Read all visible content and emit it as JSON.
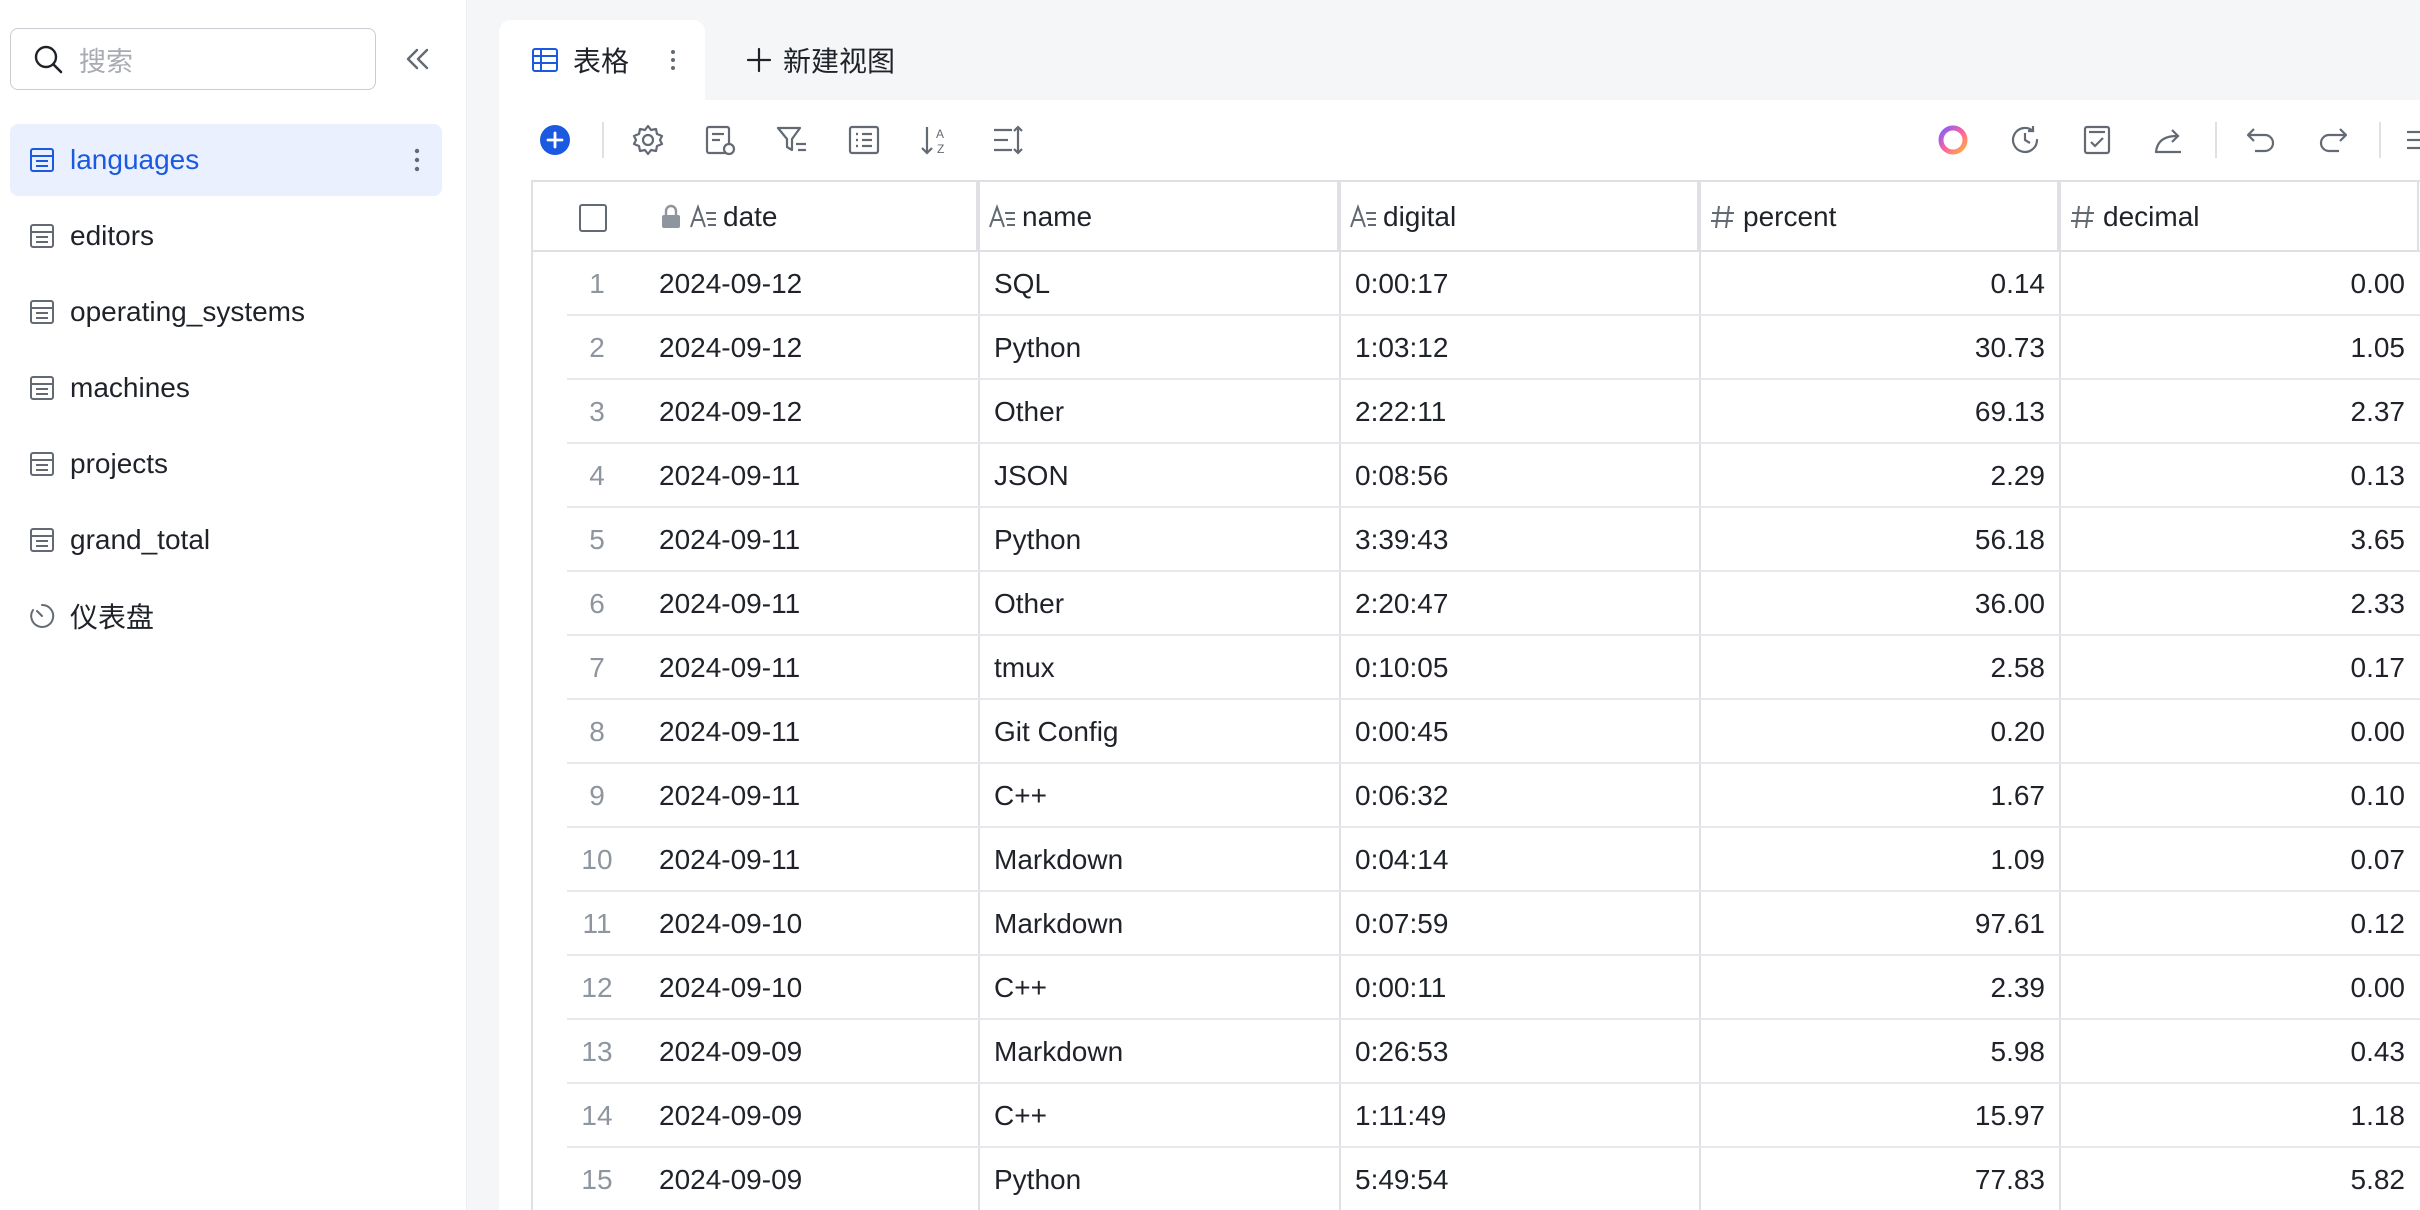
{
  "search": {
    "placeholder": "搜索"
  },
  "sidebar": {
    "items": [
      {
        "label": "languages",
        "icon": "table-icon",
        "active": true
      },
      {
        "label": "editors",
        "icon": "table-icon"
      },
      {
        "label": "operating_systems",
        "icon": "table-icon"
      },
      {
        "label": "machines",
        "icon": "table-icon"
      },
      {
        "label": "projects",
        "icon": "table-icon"
      },
      {
        "label": "grand_total",
        "icon": "table-icon"
      },
      {
        "label": "仪表盘",
        "icon": "dashboard-icon"
      }
    ]
  },
  "tabs": {
    "active_label": "表格",
    "new_view_label": "新建视图"
  },
  "table": {
    "columns": [
      {
        "label": "date",
        "type": "text",
        "locked": true
      },
      {
        "label": "name",
        "type": "text"
      },
      {
        "label": "digital",
        "type": "text"
      },
      {
        "label": "percent",
        "type": "number"
      },
      {
        "label": "decimal",
        "type": "number"
      }
    ],
    "rows": [
      {
        "idx": "1",
        "date": "2024-09-12",
        "name": "SQL",
        "digital": "0:00:17",
        "percent": "0.14",
        "decimal": "0.00"
      },
      {
        "idx": "2",
        "date": "2024-09-12",
        "name": "Python",
        "digital": "1:03:12",
        "percent": "30.73",
        "decimal": "1.05"
      },
      {
        "idx": "3",
        "date": "2024-09-12",
        "name": "Other",
        "digital": "2:22:11",
        "percent": "69.13",
        "decimal": "2.37"
      },
      {
        "idx": "4",
        "date": "2024-09-11",
        "name": "JSON",
        "digital": "0:08:56",
        "percent": "2.29",
        "decimal": "0.13"
      },
      {
        "idx": "5",
        "date": "2024-09-11",
        "name": "Python",
        "digital": "3:39:43",
        "percent": "56.18",
        "decimal": "3.65"
      },
      {
        "idx": "6",
        "date": "2024-09-11",
        "name": "Other",
        "digital": "2:20:47",
        "percent": "36.00",
        "decimal": "2.33"
      },
      {
        "idx": "7",
        "date": "2024-09-11",
        "name": "tmux",
        "digital": "0:10:05",
        "percent": "2.58",
        "decimal": "0.17"
      },
      {
        "idx": "8",
        "date": "2024-09-11",
        "name": "Git Config",
        "digital": "0:00:45",
        "percent": "0.20",
        "decimal": "0.00"
      },
      {
        "idx": "9",
        "date": "2024-09-11",
        "name": "C++",
        "digital": "0:06:32",
        "percent": "1.67",
        "decimal": "0.10"
      },
      {
        "idx": "10",
        "date": "2024-09-11",
        "name": "Markdown",
        "digital": "0:04:14",
        "percent": "1.09",
        "decimal": "0.07"
      },
      {
        "idx": "11",
        "date": "2024-09-10",
        "name": "Markdown",
        "digital": "0:07:59",
        "percent": "97.61",
        "decimal": "0.12"
      },
      {
        "idx": "12",
        "date": "2024-09-10",
        "name": "C++",
        "digital": "0:00:11",
        "percent": "2.39",
        "decimal": "0.00"
      },
      {
        "idx": "13",
        "date": "2024-09-09",
        "name": "Markdown",
        "digital": "0:26:53",
        "percent": "5.98",
        "decimal": "0.43"
      },
      {
        "idx": "14",
        "date": "2024-09-09",
        "name": "C++",
        "digital": "1:11:49",
        "percent": "15.97",
        "decimal": "1.18"
      },
      {
        "idx": "15",
        "date": "2024-09-09",
        "name": "Python",
        "digital": "5:49:54",
        "percent": "77.83",
        "decimal": "5.82"
      }
    ]
  },
  "colors": {
    "accent": "#1b5ae0",
    "active_bg": "#eaf0fd",
    "border": "#dee0e3",
    "main_bg": "#f5f6f7"
  }
}
